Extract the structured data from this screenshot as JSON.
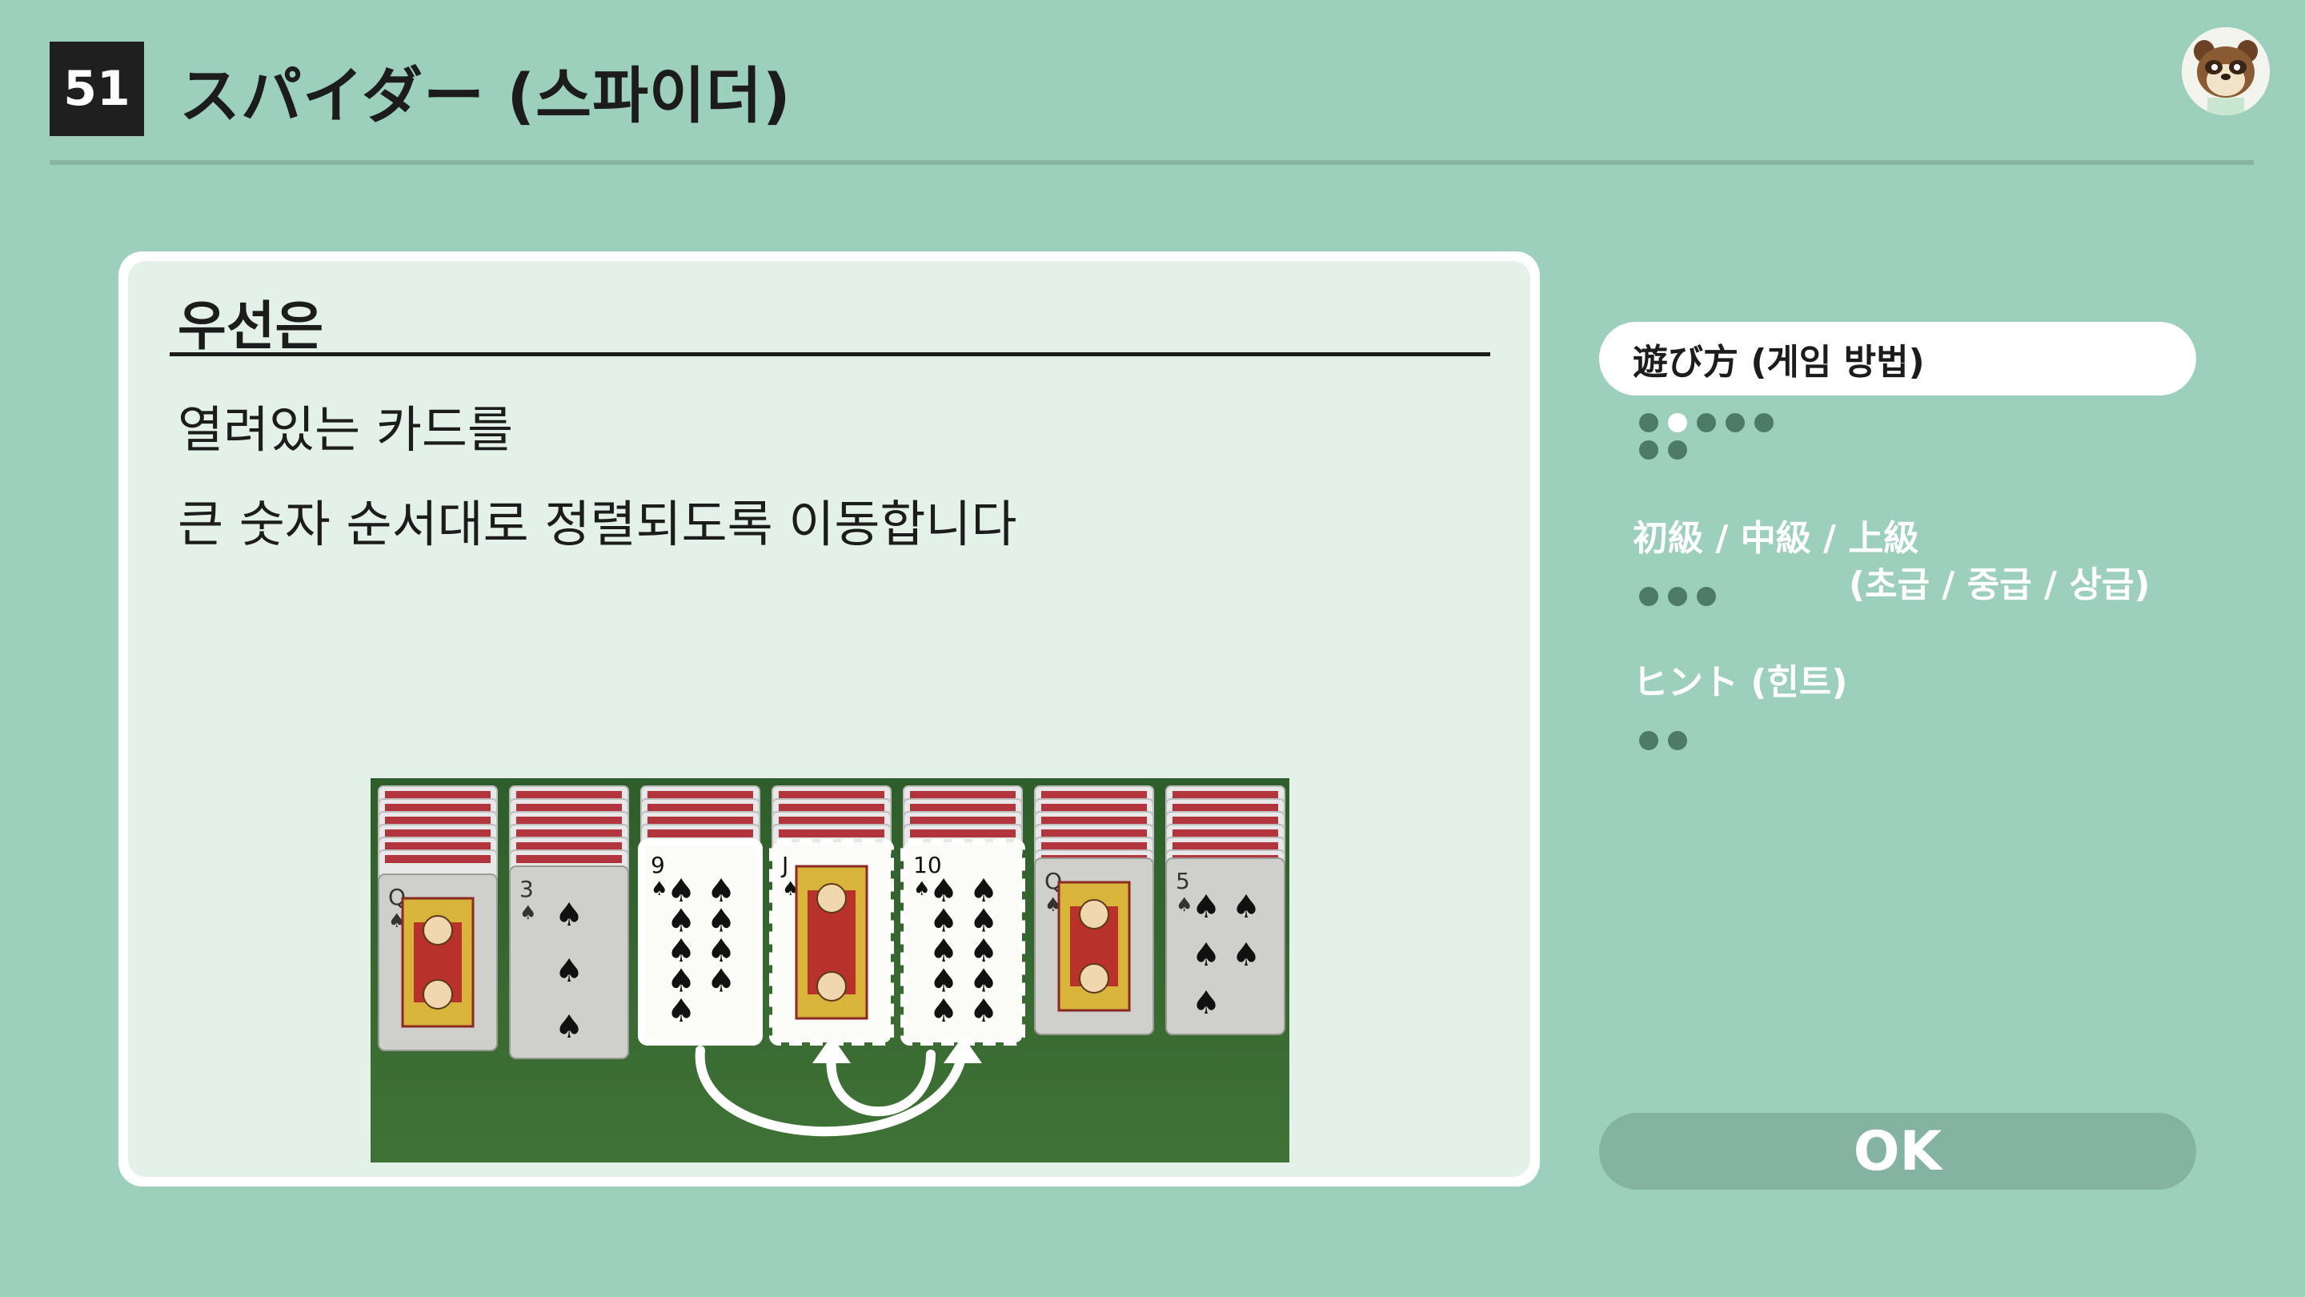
{
  "header": {
    "game_number": "51",
    "title": "スパイダー (스파이더)"
  },
  "panel": {
    "section_title": "우선은",
    "lines": [
      "열려있는 카드를",
      "큰 숫자 순서대로 정렬되도록 이동합니다"
    ],
    "cards": [
      {
        "rank": "Q",
        "suit": "♠"
      },
      {
        "rank": "3",
        "suit": "♠"
      },
      {
        "rank": "9",
        "suit": "♠"
      },
      {
        "rank": "J",
        "suit": "♠"
      },
      {
        "rank": "10",
        "suit": "♠"
      },
      {
        "rank": "Q",
        "suit": "♠"
      },
      {
        "rank": "5",
        "suit": "♠"
      }
    ]
  },
  "menu": {
    "items": [
      {
        "label": "遊び方 (게임 방법)",
        "selected": true,
        "dots": 7,
        "active_dot": 1
      },
      {
        "label": "初級 / 中級 / 上級",
        "sub": "(초급 / 중급 / 상급)",
        "selected": false,
        "dots": 3
      },
      {
        "label": "ヒント (힌트)",
        "selected": false,
        "dots": 2
      }
    ],
    "ok_label": "OK"
  },
  "colors": {
    "background": "#9dcfbd",
    "panel": "#e3f1e9",
    "felt": "#3c6d35",
    "dot_inactive": "#4d7a69",
    "dot_active": "#ffffff",
    "ok_button": "#84b3a2"
  }
}
